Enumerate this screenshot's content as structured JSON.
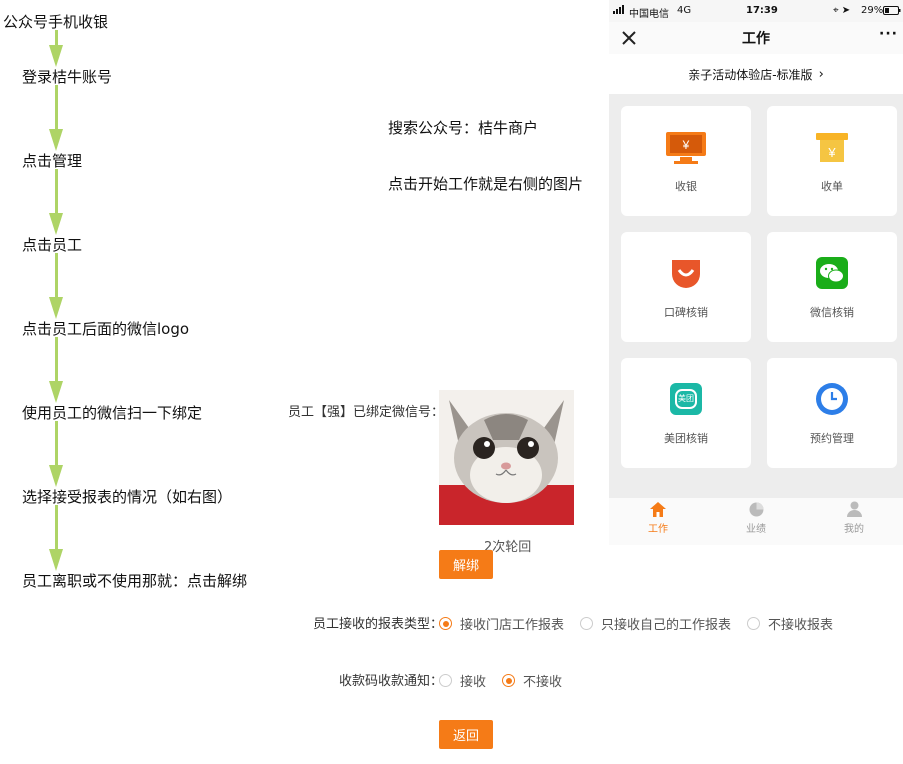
{
  "flow": {
    "steps": [
      "公众号手机收银",
      "登录桔牛账号",
      "点击管理",
      "点击员工",
      "点击员工后面的微信logo",
      "使用员工的微信扫一下绑定",
      "选择接受报表的情况（如右图）",
      "员工离职或不使用那就：点击解绑"
    ],
    "arrow_color": "#aed466"
  },
  "notes": {
    "search": "搜索公众号：桔牛商户",
    "start_work": "点击开始工作就是右侧的图片"
  },
  "binding": {
    "label": "员工【强】已绑定微信号：",
    "caption": "2次轮回",
    "unbind_button": "解绑"
  },
  "report_type": {
    "label": "员工接收的报表类型：",
    "options": [
      "接收门店工作报表",
      "只接收自己的工作报表",
      "不接收报表"
    ],
    "selected": "接收门店工作报表"
  },
  "payment_notice": {
    "label": "收款码收款通知：",
    "options": [
      "接收",
      "不接收"
    ],
    "selected": "不接收"
  },
  "back_button": "返回",
  "accent_color": "#f57b17",
  "phone": {
    "status": {
      "carrier": "中国电信",
      "network": "4G",
      "time": "17:39",
      "battery": "29%"
    },
    "nav_title": "工作",
    "store": "亲子活动体验店-标准版",
    "tiles": [
      {
        "label": "收银",
        "icon": "cashier-icon"
      },
      {
        "label": "收单",
        "icon": "receipt-icon"
      },
      {
        "label": "口碑核销",
        "icon": "koubei-icon"
      },
      {
        "label": "微信核销",
        "icon": "wechat-icon"
      },
      {
        "label": "美团核销",
        "icon": "meituan-icon"
      },
      {
        "label": "预约管理",
        "icon": "clock-icon"
      }
    ],
    "meituan_text": "美团",
    "tabs": [
      "工作",
      "业绩",
      "我的"
    ],
    "active_tab": "工作"
  }
}
